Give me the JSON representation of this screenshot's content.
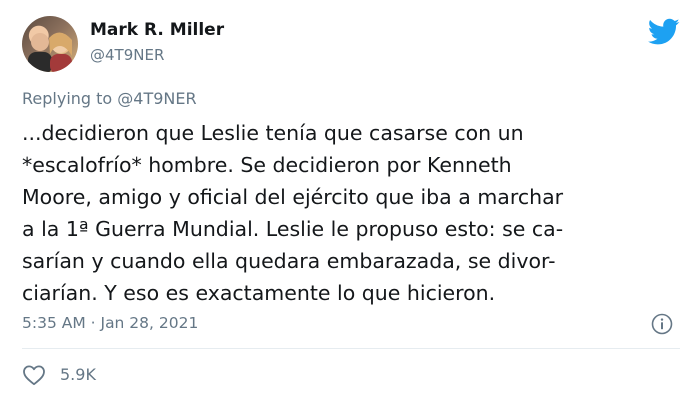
{
  "tweet": {
    "author_name": "Mark R. Miller",
    "author_handle": "@4T9NER",
    "replying_prefix": "Replying to",
    "replying_handle": "@4T9NER",
    "text_lines": [
      "...decidieron que Leslie tenía que casarse con un",
      "*escalofrío* hombre. Se decidieron por Kenneth",
      "Moore, amigo y oficial del ejército que iba a marchar",
      "a la 1ª Guerra Mundial. Leslie le propuso esto: se ca-",
      "sarían y cuando ella quedara embarazada, se divor-",
      "ciarían. Y eso es exactamente lo que hicieron."
    ],
    "timestamp": "5:35 AM · Jan 28, 2021",
    "like_count": "5.9K"
  },
  "icons": {
    "brand": "twitter-bird-icon",
    "info": "info-icon",
    "like": "heart-icon"
  },
  "colors": {
    "twitter_blue": "#1da1f2",
    "text_primary": "#14171a",
    "text_secondary": "#657786",
    "divider": "#e6ecf0"
  }
}
